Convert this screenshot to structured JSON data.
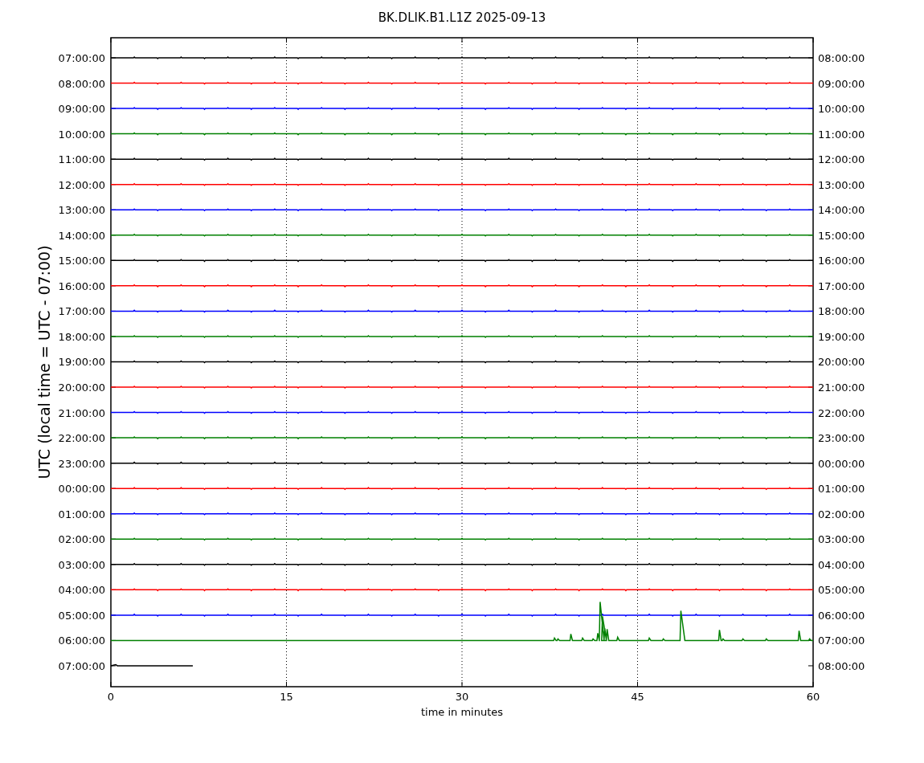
{
  "helicorder": {
    "title": "BK.DLIK.B1.L1Z 2025-09-13",
    "ylabel": "UTC (local time = UTC - 07:00)",
    "xlabel": "time in minutes",
    "xticks": [
      "0",
      "15",
      "30",
      "45",
      "60"
    ],
    "rows": [
      {
        "left": "07:00:00",
        "right": "08:00:00",
        "color": "#000000",
        "kind": "flat"
      },
      {
        "left": "08:00:00",
        "right": "09:00:00",
        "color": "#ff0000",
        "kind": "flat"
      },
      {
        "left": "09:00:00",
        "right": "10:00:00",
        "color": "#0000ff",
        "kind": "flat"
      },
      {
        "left": "10:00:00",
        "right": "11:00:00",
        "color": "#008000",
        "kind": "flat"
      },
      {
        "left": "11:00:00",
        "right": "12:00:00",
        "color": "#000000",
        "kind": "flat"
      },
      {
        "left": "12:00:00",
        "right": "13:00:00",
        "color": "#ff0000",
        "kind": "flat"
      },
      {
        "left": "13:00:00",
        "right": "14:00:00",
        "color": "#0000ff",
        "kind": "flat"
      },
      {
        "left": "14:00:00",
        "right": "15:00:00",
        "color": "#008000",
        "kind": "flat"
      },
      {
        "left": "15:00:00",
        "right": "16:00:00",
        "color": "#000000",
        "kind": "flat"
      },
      {
        "left": "16:00:00",
        "right": "17:00:00",
        "color": "#ff0000",
        "kind": "flat"
      },
      {
        "left": "17:00:00",
        "right": "18:00:00",
        "color": "#0000ff",
        "kind": "flat"
      },
      {
        "left": "18:00:00",
        "right": "19:00:00",
        "color": "#008000",
        "kind": "flat"
      },
      {
        "left": "19:00:00",
        "right": "20:00:00",
        "color": "#000000",
        "kind": "flat"
      },
      {
        "left": "20:00:00",
        "right": "21:00:00",
        "color": "#ff0000",
        "kind": "flat"
      },
      {
        "left": "21:00:00",
        "right": "22:00:00",
        "color": "#0000ff",
        "kind": "flat"
      },
      {
        "left": "22:00:00",
        "right": "23:00:00",
        "color": "#008000",
        "kind": "flat"
      },
      {
        "left": "23:00:00",
        "right": "00:00:00",
        "color": "#000000",
        "kind": "flat"
      },
      {
        "left": "00:00:00",
        "right": "01:00:00",
        "color": "#ff0000",
        "kind": "flat"
      },
      {
        "left": "01:00:00",
        "right": "02:00:00",
        "color": "#0000ff",
        "kind": "flat"
      },
      {
        "left": "02:00:00",
        "right": "03:00:00",
        "color": "#008000",
        "kind": "flat"
      },
      {
        "left": "03:00:00",
        "right": "04:00:00",
        "color": "#000000",
        "kind": "flat"
      },
      {
        "left": "04:00:00",
        "right": "05:00:00",
        "color": "#ff0000",
        "kind": "flat"
      },
      {
        "left": "05:00:00",
        "right": "06:00:00",
        "color": "#0000ff",
        "kind": "flat"
      },
      {
        "left": "06:00:00",
        "right": "07:00:00",
        "color": "#008000",
        "kind": "event"
      },
      {
        "left": "07:00:00",
        "right": "08:00:00",
        "color": "#000000",
        "kind": "partial"
      }
    ]
  }
}
